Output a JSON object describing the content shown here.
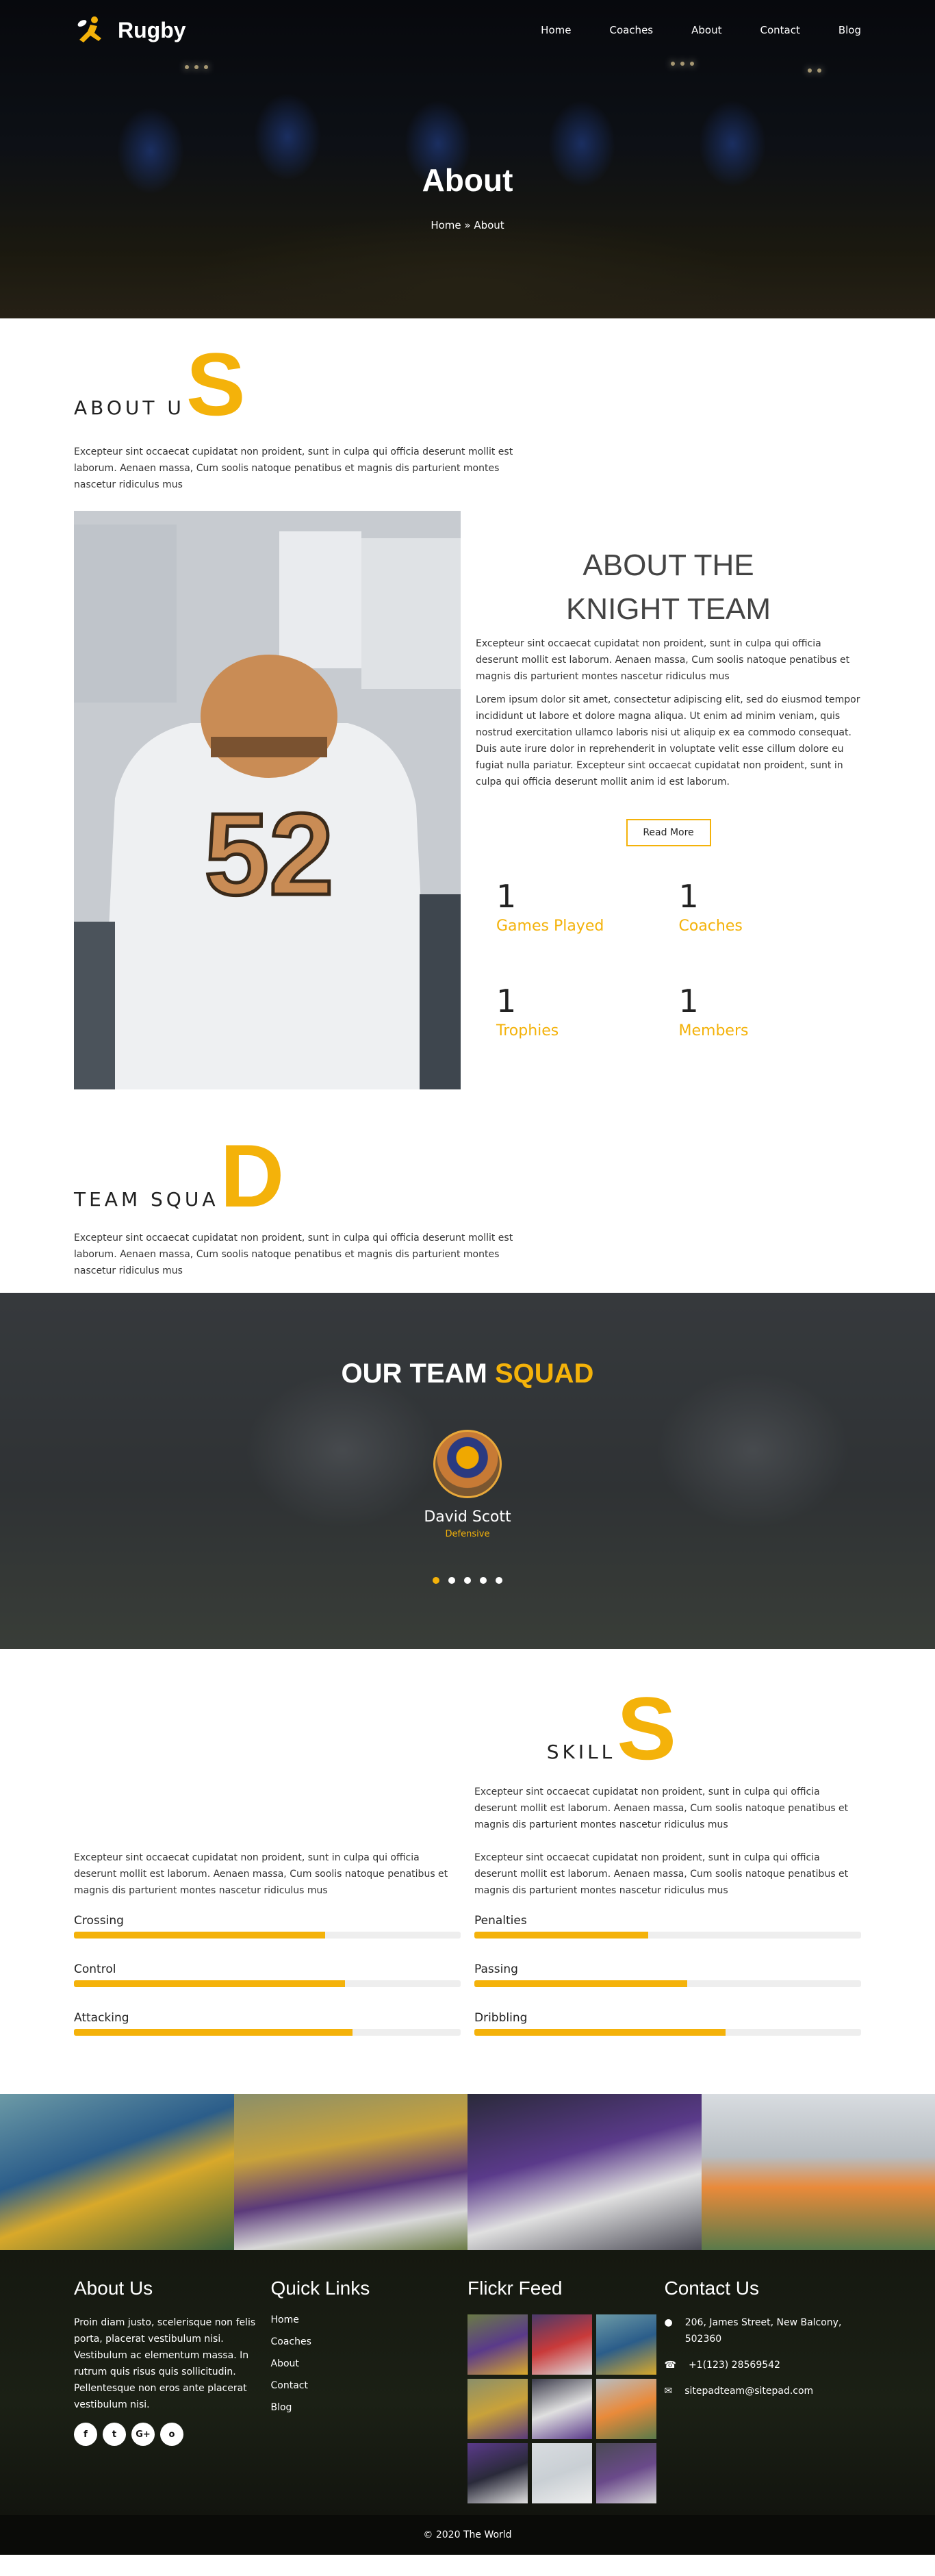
{
  "brand": {
    "name": "Rugby",
    "accent": "#f4b20a"
  },
  "nav": {
    "items": [
      "Home",
      "Coaches",
      "About",
      "Contact",
      "Blog"
    ]
  },
  "hero": {
    "title": "About",
    "breadcrumb": "Home » About"
  },
  "about_section": {
    "heading_small": "ABOUT U",
    "heading_big": "S",
    "intro": "Excepteur sint occaecat cupidatat non proident, sunt in culpa qui officia deserunt mollit est laborum. Aenaen massa, Cum soolis natoque penatibus et magnis dis parturient montes nascetur ridiculus mus",
    "title_line1": "ABOUT THE",
    "title_line2": "KNIGHT TEAM",
    "para1": "Excepteur sint occaecat cupidatat non proident, sunt in culpa qui officia deserunt mollit est laborum. Aenaen massa, Cum soolis natoque penatibus et magnis dis parturient montes nascetur ridiculus mus",
    "para2": "Lorem ipsum dolor sit amet, consectetur adipiscing elit, sed do eiusmod tempor incididunt ut labore et dolore magna aliqua. Ut enim ad minim veniam, quis nostrud exercitation ullamco laboris nisi ut aliquip ex ea commodo consequat. Duis aute irure dolor in reprehenderit in voluptate velit esse cillum dolore eu fugiat nulla pariatur. Excepteur sint occaecat cupidatat non proident, sunt in culpa qui officia deserunt mollit anim id est laborum.",
    "button": "Read More",
    "stats": [
      {
        "num": "1",
        "label": "Games Played"
      },
      {
        "num": "1",
        "label": "Coaches"
      },
      {
        "num": "1",
        "label": "Trophies"
      },
      {
        "num": "1",
        "label": "Members"
      }
    ]
  },
  "team_section": {
    "heading_small": "TEAM SQUA",
    "heading_big": "D",
    "intro": "Excepteur sint occaecat cupidatat non proident, sunt in culpa qui officia deserunt mollit est laborum. Aenaen massa, Cum soolis natoque penatibus et magnis dis parturient montes nascetur ridiculus mus",
    "squad_title_white": "OUR TEAM ",
    "squad_title_yellow": "SQUAD",
    "member_name": "David Scott",
    "member_role": "Defensive"
  },
  "skills_section": {
    "heading_small": "SKILL",
    "heading_big": "S",
    "intro_right": "Excepteur sint occaecat cupidatat non proident, sunt in culpa qui officia deserunt mollit est laborum. Aenaen massa, Cum soolis natoque penatibus et magnis dis parturient montes nascetur ridiculus mus",
    "left_text": "Excepteur sint occaecat cupidatat non proident, sunt in culpa qui officia deserunt mollit est laborum. Aenaen massa, Cum soolis natoque penatibus et magnis dis parturient montes nascetur ridiculus mus",
    "right_text": "Excepteur sint occaecat cupidatat non proident, sunt in culpa qui officia deserunt mollit est laborum. Aenaen massa, Cum soolis natoque penatibus et magnis dis parturient montes nascetur ridiculus mus",
    "left_skills": [
      {
        "label": "Crossing",
        "level": 0.65
      },
      {
        "label": "Control",
        "level": 0.7
      },
      {
        "label": "Attacking",
        "level": 0.72
      }
    ],
    "right_skills": [
      {
        "label": "Penalties",
        "level": 0.45
      },
      {
        "label": "Passing",
        "level": 0.55
      },
      {
        "label": "Dribbling",
        "level": 0.65
      }
    ]
  },
  "footer": {
    "about_title": "About Us",
    "about_text": "Proin diam justo, scelerisque non felis porta, placerat vestibulum nisi. Vestibulum ac elementum massa. In rutrum quis risus quis sollicitudin. Pellentesque non eros ante placerat vestibulum nisi.",
    "socials": [
      "f",
      "t",
      "G+",
      "o"
    ],
    "links_title": "Quick Links",
    "links": [
      "Home",
      "Coaches",
      "About",
      "Contact",
      "Blog"
    ],
    "flickr_title": "Flickr Feed",
    "contact_title": "Contact Us",
    "address": "206, James Street, New Balcony, 502360",
    "phone": "+1(123) 28569542",
    "email": "sitepadteam@sitepad.com",
    "copyright": "© 2020 The World"
  }
}
